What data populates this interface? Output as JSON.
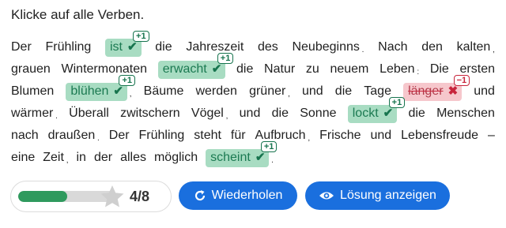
{
  "instruction": "Klicke auf alle Verben.",
  "lines": [
    [
      {
        "t": "Der"
      },
      {
        "t": "Frühling"
      },
      {
        "t": "ist",
        "chip": "correct",
        "badge": "+1",
        "icon": "check-icon"
      },
      {
        "t": "die"
      },
      {
        "t": "Jahreszeit"
      },
      {
        "t": "des"
      },
      {
        "t": "Neubeginns",
        "dot": true
      },
      {
        "t": "Nach"
      },
      {
        "t": "den"
      },
      {
        "t": "kalten",
        "comma": true
      }
    ],
    [
      {
        "t": "grauen"
      },
      {
        "t": "Wintermonaten"
      },
      {
        "t": "erwacht",
        "chip": "correct",
        "badge": "+1",
        "icon": "check-icon"
      },
      {
        "t": "die"
      },
      {
        "t": "Natur"
      },
      {
        "t": "zu"
      },
      {
        "t": "neuem"
      },
      {
        "t": "Leben",
        "colon": true
      },
      {
        "t": "Die"
      },
      {
        "t": "ersten"
      }
    ],
    [
      {
        "t": "Blumen"
      },
      {
        "t": "blühen",
        "chip": "correct",
        "badge": "+1",
        "icon": "check-icon",
        "comma": true
      },
      {
        "t": "Bäume"
      },
      {
        "t": "werden"
      },
      {
        "t": "grüner",
        "comma": true
      },
      {
        "t": "und"
      },
      {
        "t": "die"
      },
      {
        "t": "Tage"
      },
      {
        "t": "länger",
        "chip": "wrong",
        "badge": "−1",
        "icon": "cross-icon"
      },
      {
        "t": "und"
      }
    ],
    [
      {
        "t": "wärmer",
        "dot": true
      },
      {
        "t": "Überall"
      },
      {
        "t": "zwitschern"
      },
      {
        "t": "Vögel",
        "comma": true
      },
      {
        "t": "und"
      },
      {
        "t": "die"
      },
      {
        "t": "Sonne"
      },
      {
        "t": "lockt",
        "chip": "correct",
        "badge": "+1",
        "icon": "check-icon"
      },
      {
        "t": "die"
      },
      {
        "t": "Menschen"
      }
    ],
    [
      {
        "t": "nach"
      },
      {
        "t": "draußen",
        "dot": true
      },
      {
        "t": "Der"
      },
      {
        "t": "Frühling"
      },
      {
        "t": "steht"
      },
      {
        "t": "für"
      },
      {
        "t": "Aufbruch",
        "comma": true
      },
      {
        "t": "Frische"
      },
      {
        "t": "und"
      },
      {
        "t": "Lebensfreude"
      },
      {
        "t": "–"
      }
    ],
    [
      {
        "t": "eine"
      },
      {
        "t": "Zeit",
        "comma": true
      },
      {
        "t": "in"
      },
      {
        "t": "der"
      },
      {
        "t": "alles"
      },
      {
        "t": "möglich"
      },
      {
        "t": "scheint",
        "chip": "correct",
        "badge": "+1",
        "icon": "check-icon",
        "dot": true
      }
    ]
  ],
  "progress": {
    "fraction": 0.5,
    "score": "4/8",
    "star_icon": "star-icon"
  },
  "buttons": {
    "repeat": {
      "label": "Wiederholen",
      "icon": "refresh-icon"
    },
    "solution": {
      "label": "Lösung anzeigen",
      "icon": "eye-icon"
    }
  },
  "colors": {
    "correct_bg": "#a8dcc2",
    "wrong_bg": "#f6c7cc",
    "accent": "#1a6fde",
    "progress": "#2f9a5e"
  }
}
